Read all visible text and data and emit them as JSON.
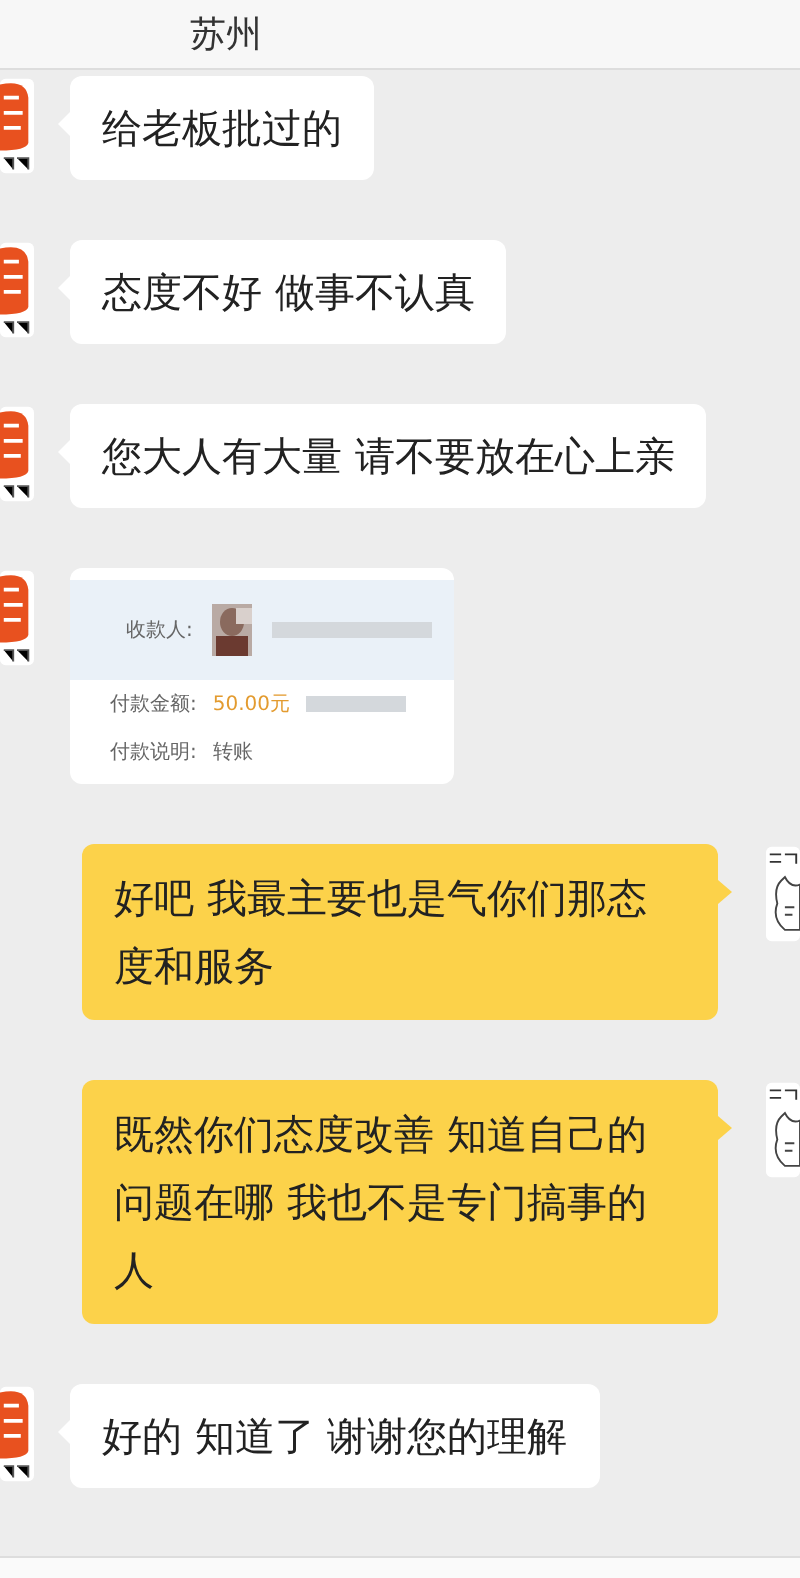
{
  "header": {
    "title": "苏州"
  },
  "messages": [
    {
      "kind": "text",
      "outgoing": false,
      "text": "给老板批过的"
    },
    {
      "kind": "text",
      "outgoing": false,
      "text": "态度不好 做事不认真"
    },
    {
      "kind": "text",
      "outgoing": false,
      "text": "您大人有大量  请不要放在心上亲"
    },
    {
      "kind": "payment",
      "outgoing": false,
      "payee_label": "收款人:",
      "amount_label": "付款金额:",
      "amount": "50.00元",
      "note_label": "付款说明:",
      "note": "转账"
    },
    {
      "kind": "text",
      "outgoing": true,
      "text": "好吧 我最主要也是气你们那态度和服务"
    },
    {
      "kind": "text",
      "outgoing": true,
      "text": "既然你们态度改善 知道自己的问题在哪 我也不是专门搞事的人"
    },
    {
      "kind": "text",
      "outgoing": false,
      "text": "好的 知道了  谢谢您的理解"
    }
  ]
}
